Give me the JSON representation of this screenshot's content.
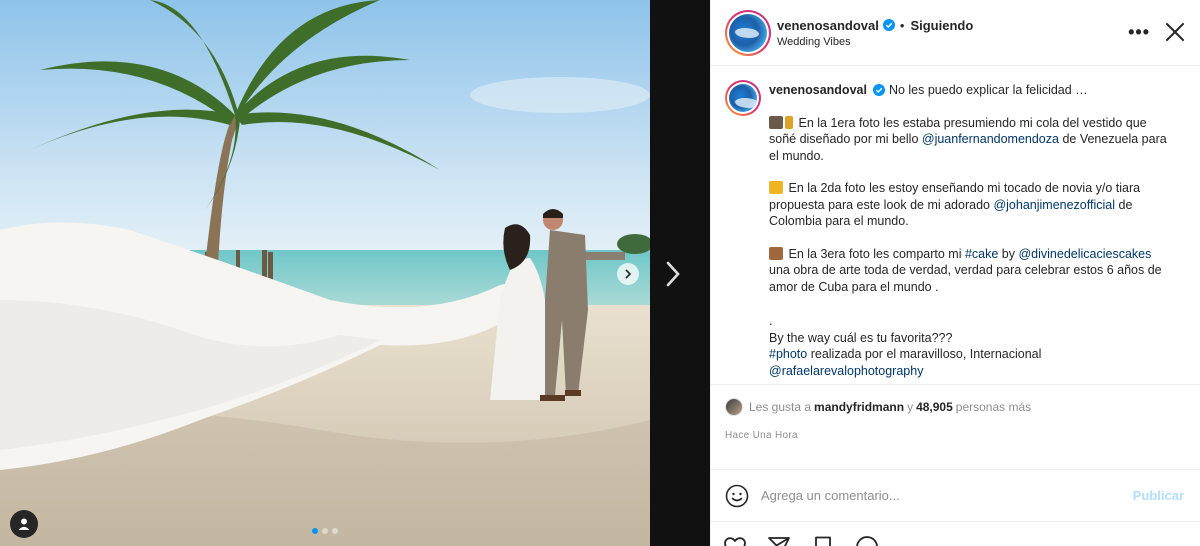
{
  "post": {
    "username": "venenosandoval",
    "follow_separator": "•",
    "follow_status": "Siguiendo",
    "location": "Wedding Vibes",
    "more_label": "•••",
    "caption": {
      "first_line": "No les puedo explicar la felicidad …",
      "p1_text1": "En la 1era foto les estaba presumiendo mi cola del vestido que soñé diseñado por mi bello ",
      "p1_link": "@juanfernandomendoza",
      "p1_text2": " de Venezuela para el mundo.",
      "p2_text1": "En la 2da foto les estoy enseñando mi tocado de novia y/o tiara propuesta para este look de mi adorado ",
      "p2_link": "@johanjimenezofficial",
      "p2_text2": " de Colombia para el mundo.",
      "p3_text1": "En la 3era foto les comparto mi ",
      "p3_tag": "#cake",
      "p3_text2": " by ",
      "p3_link": "@divinedelicaciescakes",
      "p3_text3": " una obra de arte toda de verdad, verdad para celebrar estos 6 años de amor de Cuba para el mundo .",
      "p4_dot": ".",
      "p4_line": "By the way cuál es tu favorita???",
      "p4_tag": "#photo",
      "p4_text": " realizada por el maravilloso, Internacional",
      "p4_link": "@rafaelarevalophotography"
    },
    "likes": {
      "prefix": "Les gusta a",
      "liker": "mandyfridmann",
      "middle": "y",
      "count": "48,905",
      "suffix": "personas más"
    },
    "timestamp": "Hace Una Hora",
    "comment_box": {
      "placeholder": "Agrega un comentario...",
      "post_label": "Publicar"
    }
  },
  "carousel": {
    "slides": 3,
    "current": 1
  },
  "colors": {
    "accent": "#0095f6",
    "link": "#00376b",
    "muted": "#8e8e8e",
    "post_disabled": "#b2dffc"
  },
  "icons": [
    "verified-badge-icon",
    "more-options-icon",
    "close-icon",
    "emoji-icon",
    "heart-icon",
    "share-icon",
    "bookmark-icon",
    "comment-icon",
    "chevron-right-icon",
    "user-tag-icon"
  ]
}
